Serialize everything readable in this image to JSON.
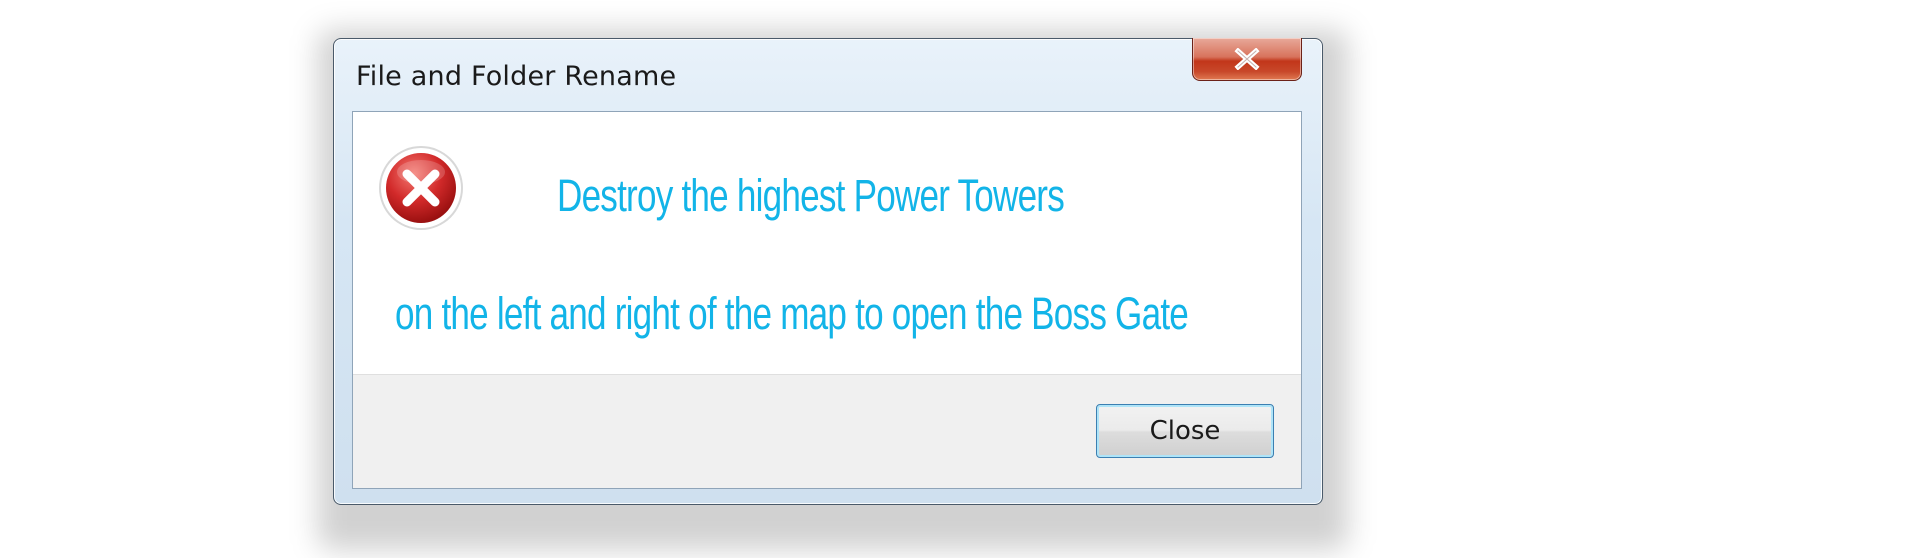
{
  "dialog": {
    "title": "File and Folder Rename",
    "icon": "error-icon",
    "message_lines": [
      "Destroy the highest Power Towers",
      "on the left and right of the map to open the Boss Gate"
    ],
    "close_button_label": "Close",
    "title_close_icon": "close-icon"
  },
  "colors": {
    "message_text": "#12b4e8",
    "error_red": "#c8202a",
    "title_close_red": "#c2361a"
  }
}
